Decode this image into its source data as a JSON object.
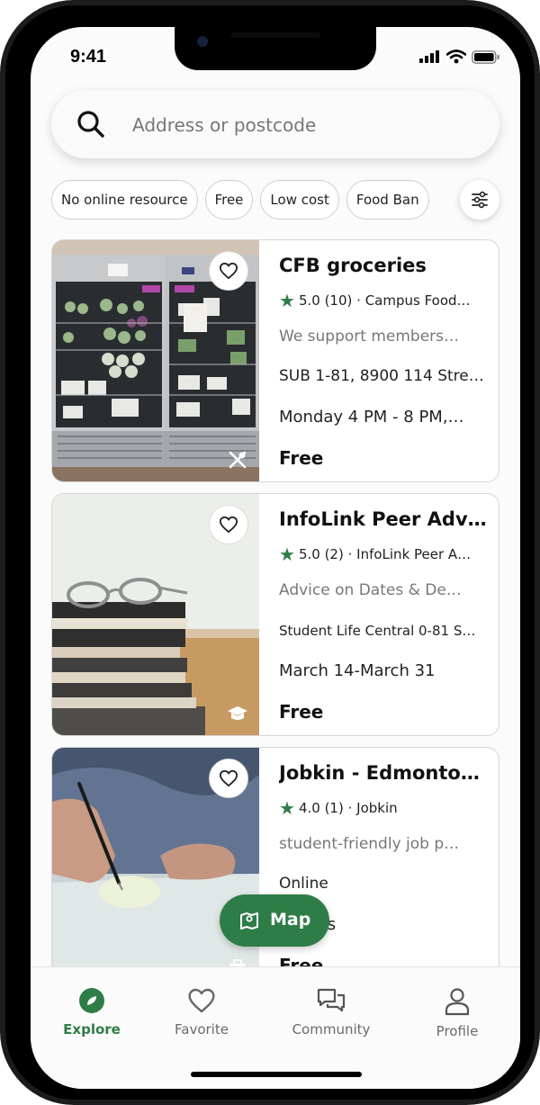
{
  "status_bar": {
    "time": "9:41"
  },
  "search": {
    "placeholder": "Address or postcode",
    "icon": "search-icon"
  },
  "filters": {
    "chips": [
      "No online resource",
      "Free",
      "Low cost",
      "Food Ban"
    ],
    "settings_icon": "sliders-icon"
  },
  "listings": [
    {
      "title": "CFB groceries",
      "rating": "5.0",
      "reviews": "(10)",
      "provider": "· Campus Food…",
      "description": "We support members…",
      "address": "SUB 1-81, 8900 114 Stre…",
      "hours": "Monday 4 PM - 8 PM,…",
      "price": "Free",
      "category_icon": "fork-knife-icon"
    },
    {
      "title": "InfoLink Peer Advi…",
      "rating": "5.0",
      "reviews": "(2)",
      "provider": "· InfoLink Peer A…",
      "description": "Advice on Dates & De…",
      "address": "Student Life Central 0-81 S…",
      "hours": "March 14-March 31",
      "price": "Free",
      "category_icon": "graduation-cap-icon"
    },
    {
      "title": "Jobkin - Edmonto…",
      "rating": "4.0",
      "reviews": "(1)",
      "provider": "· Jobkin",
      "description": "student-friendly job p…",
      "address": "Online",
      "hours": "Always",
      "price": "Free",
      "category_icon": "briefcase-icon"
    }
  ],
  "map_button": {
    "label": "Map"
  },
  "bottom_nav": [
    {
      "label": "Explore",
      "icon": "compass-icon",
      "active": true
    },
    {
      "label": "Favorite",
      "icon": "heart-icon",
      "active": false
    },
    {
      "label": "Community",
      "icon": "chat-icon",
      "active": false
    },
    {
      "label": "Profile",
      "icon": "person-icon",
      "active": false
    }
  ],
  "colors": {
    "accent": "#2e7d46",
    "text": "#111111",
    "muted": "#777777"
  }
}
